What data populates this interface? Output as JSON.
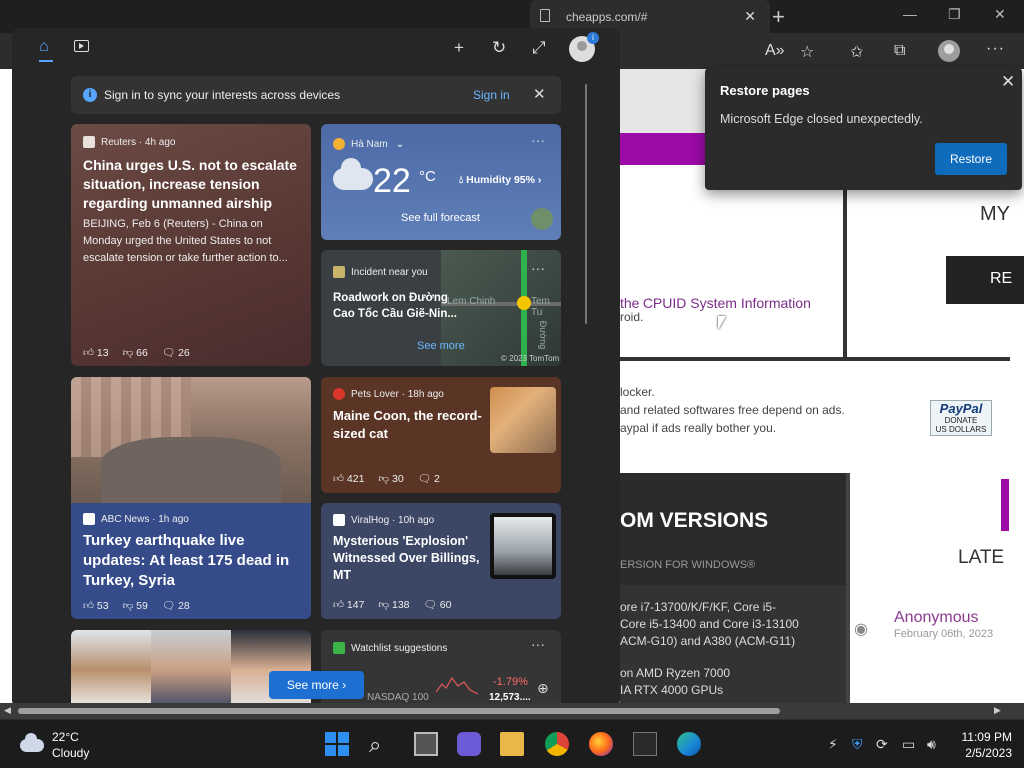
{
  "browser": {
    "tabs": [
      {
        "label": "cheapps.com/#"
      }
    ],
    "new_tab": "+",
    "tab_close": "✕",
    "window_controls": {
      "minimize": "—",
      "restore": "❐",
      "close": "✕"
    }
  },
  "webpage": {
    "cpuid_prefix": "the",
    "cpuid_link": "CPUID System Information",
    "android_text": "roid.",
    "blocker_text": "locker.",
    "line2": "and related softwares free depend on ads.",
    "line3": "aypal if ads really bother you.",
    "paypal": {
      "brand": "PayPal",
      "donate": "DONATE",
      "currency": "US DOLLARS"
    },
    "my_text": "MY",
    "re_button": "RE",
    "versions_title": "OM VERSIONS",
    "versions_sub": "ERSION FOR WINDOWS®",
    "cpu_lines": [
      "ore i7-13700/K/F/KF, Core i5-",
      "Core i5-13400 and Core i3-13100",
      "ACM-G10) and A380 (ACM-G11)"
    ],
    "gpu_lines": [
      "on AMD Ryzen 7000",
      "IA RTX 4000 GPUs"
    ],
    "late_text": "LATE",
    "comment": {
      "author": "Anonymous",
      "date": "February 06th, 2023"
    }
  },
  "restore_popup": {
    "title": "Restore pages",
    "message": "Microsoft Edge closed unexpectedly.",
    "button": "Restore",
    "close": "✕"
  },
  "widgets": {
    "signin_bar": {
      "message": "Sign in to sync your interests across devices",
      "link": "Sign in",
      "close": "✕",
      "info": "i"
    },
    "badge": "i",
    "china": {
      "source": "Reuters · 4h ago",
      "headline": "China urges U.S. not to escalate situation, increase tension regarding unmanned airship",
      "body": "BEIJING, Feb 6 (Reuters) - China on Monday urged the United States to not escalate tension or take further action to...",
      "likes": "13",
      "dislikes": "66",
      "comments": "26"
    },
    "weather": {
      "location": "Hà Nam",
      "temp": "22",
      "unit": "°C",
      "humidity": "Humidity 95%",
      "forecast": "See full forecast",
      "more": "···"
    },
    "incident": {
      "label": "Incident near you",
      "headline": "Roadwork on Đường Cao Tốc Cầu Giẽ-Nin...",
      "see_more": "See more",
      "map_labels": [
        "Lem Chinh",
        "Tem Tu",
        "Đường"
      ],
      "credit": "© 2023 TomTom",
      "more": "···"
    },
    "turkey": {
      "source": "ABC News · 1h ago",
      "headline": "Turkey earthquake live updates: At least 175 dead in Turkey, Syria",
      "likes": "53",
      "dislikes": "59",
      "comments": "28"
    },
    "maine": {
      "source": "Pets Lover · 18h ago",
      "headline": "Maine Coon, the record-sized cat",
      "likes": "421",
      "dislikes": "30",
      "comments": "2"
    },
    "viral": {
      "source": "ViralHog · 10h ago",
      "headline": "Mysterious 'Explosion' Witnessed Over Billings, MT",
      "likes": "147",
      "dislikes": "138",
      "comments": "60"
    },
    "watchlist": {
      "label": "Watchlist suggestions",
      "index": "NASDAQ 100",
      "change": "-1.79%",
      "value": "12,573....",
      "more": "···"
    },
    "see_more_button": "See more"
  },
  "taskbar": {
    "weather_temp": "22°C",
    "weather_desc": "Cloudy",
    "time": "11:09 PM",
    "date": "2/5/2023"
  },
  "colors": {
    "accent": "#0f6cbd",
    "link_blue": "#6cb8ff",
    "purple": "#9c0aa7"
  }
}
